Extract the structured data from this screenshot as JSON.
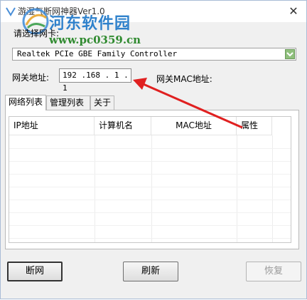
{
  "window": {
    "title": "游湿气断网神器Ver1.0",
    "close_label": "✕"
  },
  "watermark": {
    "title": "河东软件园",
    "url": "www.pc0359.cn"
  },
  "nic": {
    "label": "请选择网卡:",
    "selected": "Realtek PCIe GBE Family Controller"
  },
  "gateway": {
    "label": "网关地址:",
    "value": "192 .168 . 1  . 1",
    "mac_label": "网关MAC地址:"
  },
  "tabs": [
    {
      "label": "网络列表"
    },
    {
      "label": "管理列表"
    },
    {
      "label": "关于"
    }
  ],
  "table": {
    "columns": [
      "IP地址",
      "计算机名",
      "MAC地址",
      "属性"
    ]
  },
  "buttons": {
    "disconnect": "断网",
    "refresh": "刷新",
    "restore": "恢复"
  },
  "colors": {
    "window_bg": "#f0f0f0",
    "arrow": "#e02020",
    "watermark_blue": "#1f78c8",
    "watermark_green": "#2f8a2f"
  }
}
